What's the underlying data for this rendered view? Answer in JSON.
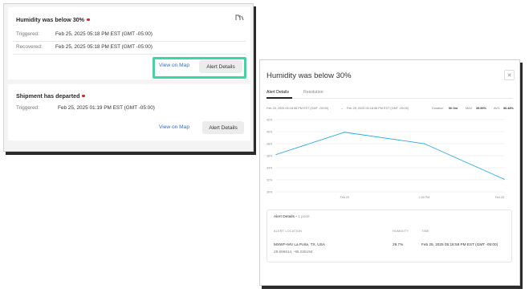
{
  "alerts": [
    {
      "title": "Humidity was below 30%",
      "rows": [
        {
          "label": "Triggered:",
          "value": "Feb 25, 2025 05:18 PM EST (GMT -05:00)"
        },
        {
          "label": "Recovered:",
          "value": "Feb 25, 2025 05:18 PM EST (GMT -05:00)"
        }
      ],
      "map_link": "View on Map",
      "details_button": "Alert Details",
      "status_color": "#d8232a"
    },
    {
      "title": "Shipment has departed",
      "rows": [
        {
          "label": "Triggered:",
          "value": "Feb 25, 2025 01:19 PM EST (GMT -05:00)"
        }
      ],
      "map_link": "View on Map",
      "details_button": "Alert Details",
      "status_color": "#d8232a"
    }
  ],
  "highlight_color": "#3ad8a5",
  "modal": {
    "title": "Humidity was below 30%",
    "close_icon": "close-icon",
    "tabs": [
      {
        "label": "Alert Details",
        "active": true
      },
      {
        "label": "Resolution",
        "active": false
      }
    ],
    "range": {
      "start": "Feb 25, 2025 05:18:58 PM EST (GMT -05:00)",
      "arrow": "→",
      "end": "Feb 25, 2025 05:18:58 PM EST (GMT -05:00)",
      "duration_label": "Duration",
      "duration_value": "0h 0m",
      "max_label": "MAX",
      "max_value": "39.90%",
      "avg_label": "AVG",
      "avg_value": "36.48%"
    },
    "details": {
      "title": "Alert Details",
      "count": "• 1 point",
      "headers": [
        "ALERT LOCATION",
        "HUMIDITY",
        "TIME"
      ],
      "row": {
        "location": "MXWF+MV La Porte, TX, USA",
        "coords": "29.696614, -95.025194",
        "humidity": "29.7%",
        "time": "Feb 25, 2025 05:18:58 PM EST (GMT -05:00)"
      }
    }
  },
  "chart_data": {
    "type": "line",
    "ylabel": "",
    "xlabel": "",
    "y_ticks": [
      "42%",
      "40%",
      "38%",
      "36%",
      "34%",
      "32%",
      "30%"
    ],
    "ylim": [
      30,
      42
    ],
    "x_tick_labels": [
      "Feb 25",
      "1:00 PM",
      "Feb 25"
    ],
    "grid": true,
    "line_color": "#2aa7df",
    "series": [
      {
        "x": [
          0,
          0.3,
          0.65,
          1.0
        ],
        "values": [
          36.2,
          39.9,
          38.0,
          32.1
        ]
      }
    ]
  }
}
